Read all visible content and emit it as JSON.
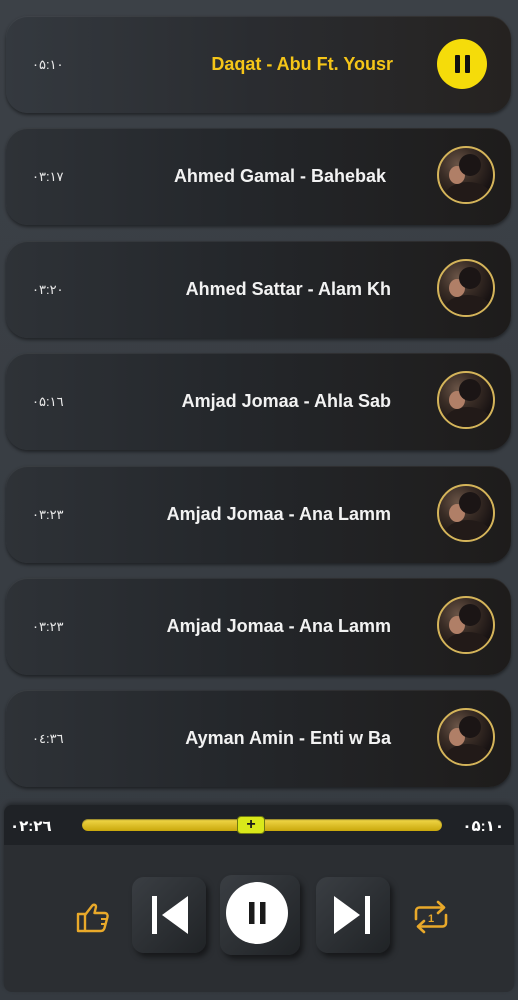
{
  "tracks": [
    {
      "title": "Daqat - Abu Ft. Yousr",
      "duration": "۰۵:۱۰",
      "active": true
    },
    {
      "title": "Ahmed Gamal - Bahebak",
      "duration": "۰۳:۱۷"
    },
    {
      "title": "Ahmed Sattar - Alam Kh",
      "duration": "۰۳:۲۰"
    },
    {
      "title": "Amjad Jomaa - Ahla Sab",
      "duration": "۰۵:۱٦"
    },
    {
      "title": "Amjad Jomaa - Ana Lamm",
      "duration": "۰۳:۲۳"
    },
    {
      "title": "Amjad Jomaa - Ana Lamm",
      "duration": "۰۳:۲۳"
    },
    {
      "title": "Ayman Amin - Enti w Ba",
      "duration": "۰٤:۳٦"
    }
  ],
  "player": {
    "elapsed": "۰۲:۲٦",
    "total": "۰۵:۱۰",
    "progress": 0.47,
    "repeat_badge": "1"
  },
  "colors": {
    "accent": "#f5c518",
    "play_button": "#f5dc0a",
    "seek_bar": "#e1c224",
    "knob": "#d9e81a"
  },
  "icons": {
    "like": "thumbs-up-icon",
    "previous": "skip-previous-icon",
    "pause": "pause-icon",
    "next": "skip-next-icon",
    "repeat": "repeat-one-icon"
  }
}
